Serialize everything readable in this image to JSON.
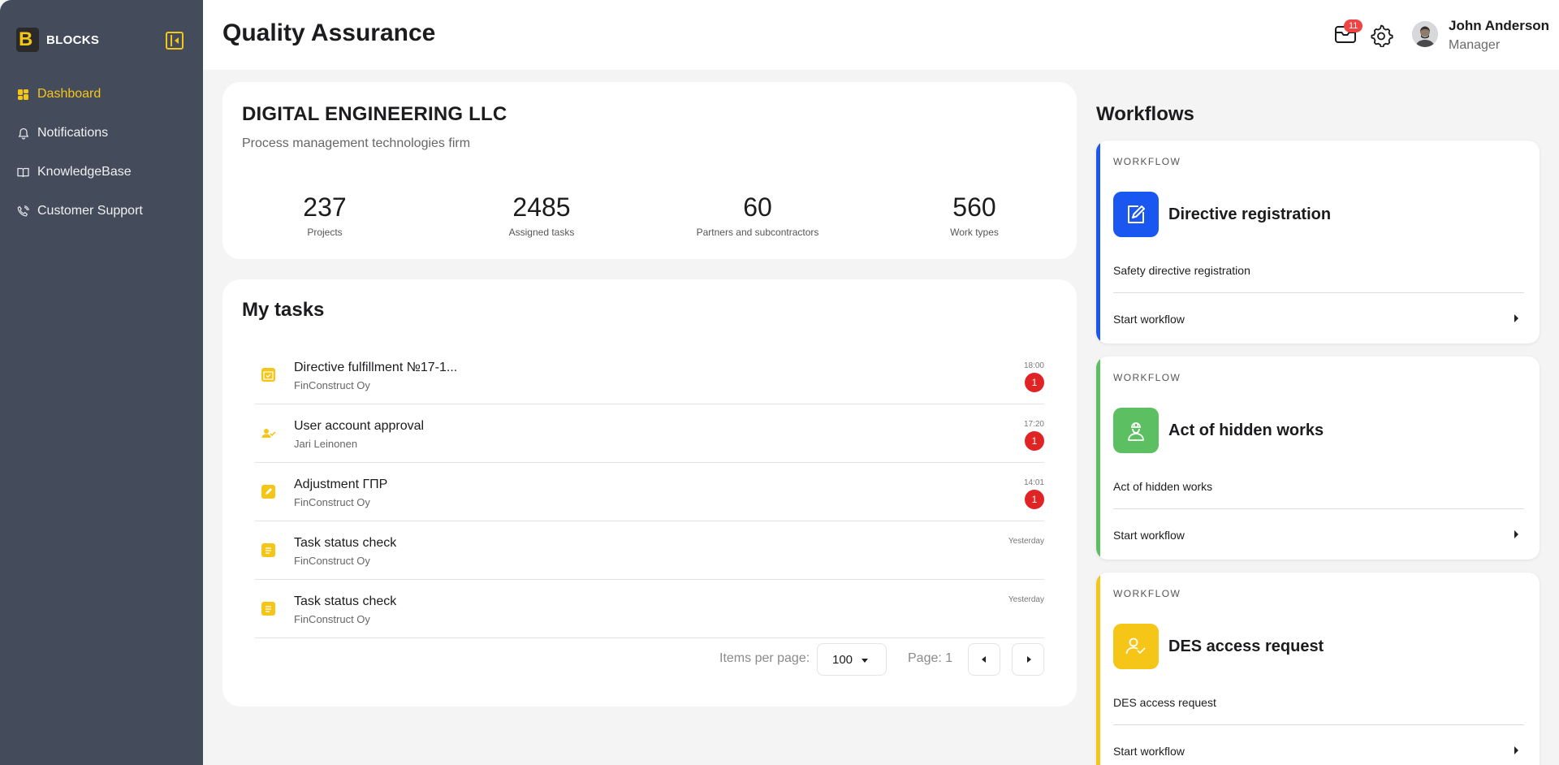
{
  "app": {
    "brand": "BLOCKS",
    "logo_letter": "B"
  },
  "sidebar": {
    "items": [
      {
        "label": "Dashboard",
        "icon": "dashboard-icon",
        "active": true
      },
      {
        "label": "Notifications",
        "icon": "bell-icon"
      },
      {
        "label": "KnowledgeBase",
        "icon": "book-icon"
      },
      {
        "label": "Customer Support",
        "icon": "phone-icon"
      }
    ]
  },
  "header": {
    "title": "Quality Assurance",
    "mail_count": "11",
    "user": {
      "name": "John Anderson",
      "role": "Manager"
    }
  },
  "company": {
    "name": "DIGITAL ENGINEERING LLC",
    "description": "Process management technologies firm",
    "stats": [
      {
        "value": "237",
        "label": "Projects"
      },
      {
        "value": "2485",
        "label": "Assigned tasks"
      },
      {
        "value": "60",
        "label": "Partners and subcontractors"
      },
      {
        "value": "560",
        "label": "Work types"
      }
    ]
  },
  "tasks": {
    "title": "My tasks",
    "items": [
      {
        "name": "Directive fulfillment №17-1...",
        "sub": "FinConstruct Oy",
        "time": "18:00",
        "badge": "1",
        "icon": "calendar-check-icon"
      },
      {
        "name": "User account approval",
        "sub": "Jari Leinonen",
        "time": "17:20",
        "badge": "1",
        "icon": "user-check-icon"
      },
      {
        "name": "Adjustment ГПР",
        "sub": "FinConstruct Oy",
        "time": "14:01",
        "badge": "1",
        "icon": "edit-icon"
      },
      {
        "name": "Task status check",
        "sub": "FinConstruct Oy",
        "time": "Yesterday",
        "badge": "",
        "icon": "document-icon"
      },
      {
        "name": "Task status check",
        "sub": "FinConstruct Oy",
        "time": "Yesterday",
        "badge": "",
        "icon": "document-icon"
      }
    ],
    "pager": {
      "items_per_page_label": "Items per page:",
      "items_per_page_value": "100",
      "page_label": "Page: 1"
    }
  },
  "workflows": {
    "title": "Workflows",
    "cards": [
      {
        "tag": "WORKFLOW",
        "name": "Directive registration",
        "description": "Safety directive registration",
        "action": "Start workflow",
        "color": "#1a56f0",
        "icon": "edit-document-icon"
      },
      {
        "tag": "WORKFLOW",
        "name": "Act of hidden works",
        "description": "Act of hidden works",
        "action": "Start workflow",
        "color": "#5cbf62",
        "icon": "worker-icon"
      },
      {
        "tag": "WORKFLOW",
        "name": "DES access request",
        "description": "DES access request",
        "action": "Start workflow",
        "color": "#f5c518",
        "icon": "user-check-icon"
      }
    ]
  },
  "colors": {
    "accent": "#f5c518",
    "sidebar": "#444c5c",
    "badge": "#e02424"
  }
}
